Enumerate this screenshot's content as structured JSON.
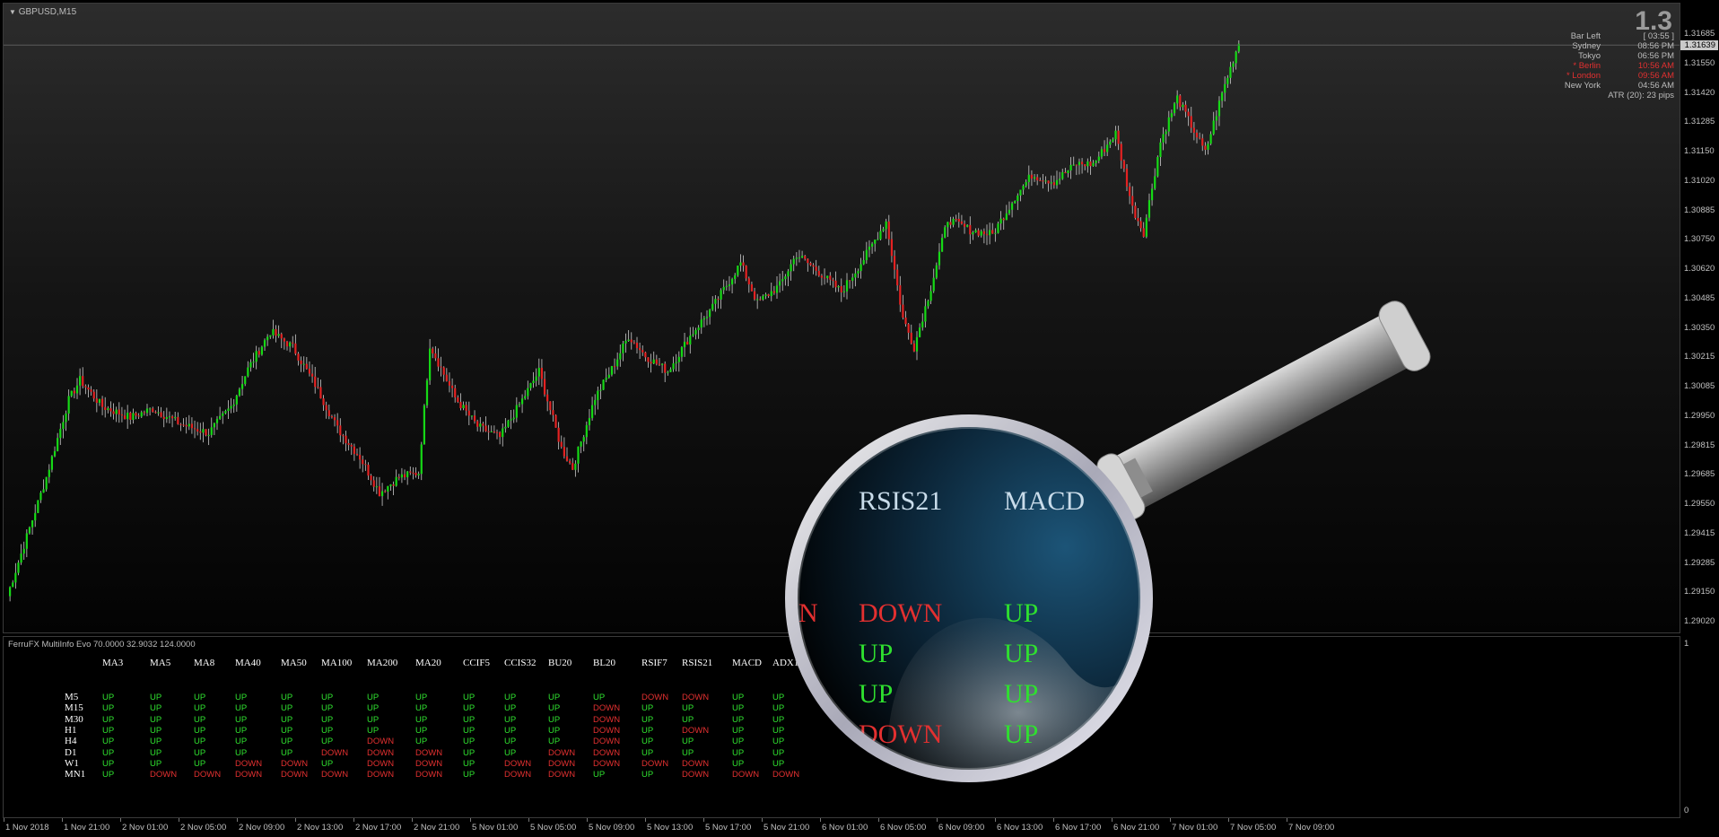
{
  "chart": {
    "symbol": "GBPUSD,M15",
    "big_price": "1.3",
    "current_price": "1.31639",
    "colors": {
      "bull": "#16d916",
      "bear": "#e42222",
      "wick": "#cccccc",
      "background": "#000000"
    },
    "info": [
      {
        "label": "Bar Left",
        "value": "[ 03:55 ]",
        "highlight": false
      },
      {
        "label": "Sydney",
        "value": "08:56 PM",
        "highlight": false
      },
      {
        "label": "Tokyo",
        "value": "06:56 PM",
        "highlight": false
      },
      {
        "label": "* Berlin",
        "value": "10:56 AM",
        "highlight": true
      },
      {
        "label": "* London",
        "value": "09:56 AM",
        "highlight": true
      },
      {
        "label": "New York",
        "value": "04:56 AM",
        "highlight": false
      },
      {
        "label": "ATR (20): 23 pips",
        "value": "",
        "highlight": false
      }
    ],
    "price_ticks": [
      "1.31685",
      "1.31550",
      "1.31420",
      "1.31285",
      "1.31150",
      "1.31020",
      "1.30885",
      "1.30750",
      "1.30620",
      "1.30485",
      "1.30350",
      "1.30215",
      "1.30085",
      "1.29950",
      "1.29815",
      "1.29685",
      "1.29550",
      "1.29415",
      "1.29285",
      "1.29150",
      "1.29020"
    ],
    "time_ticks": [
      "1 Nov 2018",
      "1 Nov 21:00",
      "2 Nov 01:00",
      "2 Nov 05:00",
      "2 Nov 09:00",
      "2 Nov 13:00",
      "2 Nov 17:00",
      "2 Nov 21:00",
      "5 Nov 01:00",
      "5 Nov 05:00",
      "5 Nov 09:00",
      "5 Nov 13:00",
      "5 Nov 17:00",
      "5 Nov 21:00",
      "6 Nov 01:00",
      "6 Nov 05:00",
      "6 Nov 09:00",
      "6 Nov 13:00",
      "6 Nov 17:00",
      "6 Nov 21:00",
      "7 Nov 01:00",
      "7 Nov 05:00",
      "7 Nov 09:00"
    ],
    "close_path": [
      [
        1.2914,
        0
      ],
      [
        1.2968,
        14
      ],
      [
        1.3003,
        22
      ],
      [
        1.3012,
        26
      ],
      [
        1.3,
        34
      ],
      [
        1.2995,
        44
      ],
      [
        1.2999,
        52
      ],
      [
        1.2992,
        62
      ],
      [
        1.2988,
        72
      ],
      [
        1.3,
        80
      ],
      [
        1.3017,
        86
      ],
      [
        1.3034,
        94
      ],
      [
        1.3027,
        102
      ],
      [
        1.301,
        110
      ],
      [
        1.299,
        118
      ],
      [
        1.2977,
        126
      ],
      [
        1.2961,
        133
      ],
      [
        1.2968,
        140
      ],
      [
        1.297,
        147
      ],
      [
        1.3028,
        151
      ],
      [
        1.3004,
        160
      ],
      [
        1.2991,
        168
      ],
      [
        1.2986,
        176
      ],
      [
        1.3003,
        184
      ],
      [
        1.3016,
        190
      ],
      [
        1.2981,
        198
      ],
      [
        1.2972,
        202
      ],
      [
        1.3004,
        210
      ],
      [
        1.3017,
        216
      ],
      [
        1.3032,
        222
      ],
      [
        1.3023,
        228
      ],
      [
        1.3016,
        236
      ],
      [
        1.3032,
        244
      ],
      [
        1.3045,
        252
      ],
      [
        1.3065,
        262
      ],
      [
        1.3047,
        268
      ],
      [
        1.3055,
        276
      ],
      [
        1.3069,
        282
      ],
      [
        1.3061,
        290
      ],
      [
        1.3052,
        298
      ],
      [
        1.3067,
        306
      ],
      [
        1.3084,
        314
      ],
      [
        1.304,
        320
      ],
      [
        1.3027,
        324
      ],
      [
        1.3054,
        330
      ],
      [
        1.3085,
        336
      ],
      [
        1.308,
        344
      ],
      [
        1.3078,
        352
      ],
      [
        1.3095,
        360
      ],
      [
        1.3105,
        366
      ],
      [
        1.3102,
        374
      ],
      [
        1.311,
        382
      ],
      [
        1.311,
        388
      ],
      [
        1.3124,
        396
      ],
      [
        1.309,
        402
      ],
      [
        1.3079,
        406
      ],
      [
        1.312,
        412
      ],
      [
        1.314,
        418
      ],
      [
        1.3125,
        424
      ],
      [
        1.3115,
        428
      ],
      [
        1.3142,
        434
      ],
      [
        1.3165,
        440
      ]
    ]
  },
  "indicator": {
    "title": "FerruFX MultiInfo Evo 70.0000 32.9032 124.0000",
    "axis_top": "1",
    "axis_bottom": "0",
    "columns": [
      "MA3",
      "MA5",
      "MA8",
      "MA40",
      "MA50",
      "MA100",
      "MA200",
      "MA20",
      "CCIF5",
      "CCIS32",
      "BU20",
      "BL20",
      "RSIF7",
      "RSIS21",
      "MACD",
      "ADX1"
    ],
    "rows": [
      {
        "tf": "M5",
        "vals": [
          "UP",
          "UP",
          "UP",
          "UP",
          "UP",
          "UP",
          "UP",
          "UP",
          "UP",
          "UP",
          "UP",
          "UP",
          "DOWN",
          "DOWN",
          "UP",
          "UP"
        ]
      },
      {
        "tf": "M15",
        "vals": [
          "UP",
          "UP",
          "UP",
          "UP",
          "UP",
          "UP",
          "UP",
          "UP",
          "UP",
          "UP",
          "UP",
          "DOWN",
          "UP",
          "UP",
          "UP",
          "UP"
        ]
      },
      {
        "tf": "M30",
        "vals": [
          "UP",
          "UP",
          "UP",
          "UP",
          "UP",
          "UP",
          "UP",
          "UP",
          "UP",
          "UP",
          "UP",
          "DOWN",
          "UP",
          "UP",
          "UP",
          "UP"
        ]
      },
      {
        "tf": "H1",
        "vals": [
          "UP",
          "UP",
          "UP",
          "UP",
          "UP",
          "UP",
          "UP",
          "UP",
          "UP",
          "UP",
          "UP",
          "DOWN",
          "UP",
          "DOWN",
          "UP",
          "UP"
        ]
      },
      {
        "tf": "H4",
        "vals": [
          "UP",
          "UP",
          "UP",
          "UP",
          "UP",
          "UP",
          "DOWN",
          "UP",
          "UP",
          "UP",
          "UP",
          "DOWN",
          "UP",
          "UP",
          "UP",
          "UP"
        ]
      },
      {
        "tf": "D1",
        "vals": [
          "UP",
          "UP",
          "UP",
          "UP",
          "UP",
          "DOWN",
          "DOWN",
          "DOWN",
          "UP",
          "UP",
          "DOWN",
          "DOWN",
          "UP",
          "UP",
          "UP",
          "UP"
        ]
      },
      {
        "tf": "W1",
        "vals": [
          "UP",
          "UP",
          "UP",
          "DOWN",
          "DOWN",
          "UP",
          "DOWN",
          "DOWN",
          "UP",
          "DOWN",
          "DOWN",
          "DOWN",
          "DOWN",
          "DOWN",
          "UP",
          "UP"
        ]
      },
      {
        "tf": "MN1",
        "vals": [
          "UP",
          "DOWN",
          "DOWN",
          "DOWN",
          "DOWN",
          "DOWN",
          "DOWN",
          "DOWN",
          "UP",
          "DOWN",
          "DOWN",
          "UP",
          "UP",
          "DOWN",
          "DOWN",
          "DOWN"
        ]
      }
    ]
  },
  "magnifier": {
    "headers": [
      "RSIS21",
      "MACD"
    ],
    "rows": [
      [
        "DOWN",
        "UP"
      ],
      [
        "UP",
        "UP"
      ],
      [
        "UP",
        "UP"
      ],
      [
        "DOWN",
        "UP"
      ]
    ]
  }
}
